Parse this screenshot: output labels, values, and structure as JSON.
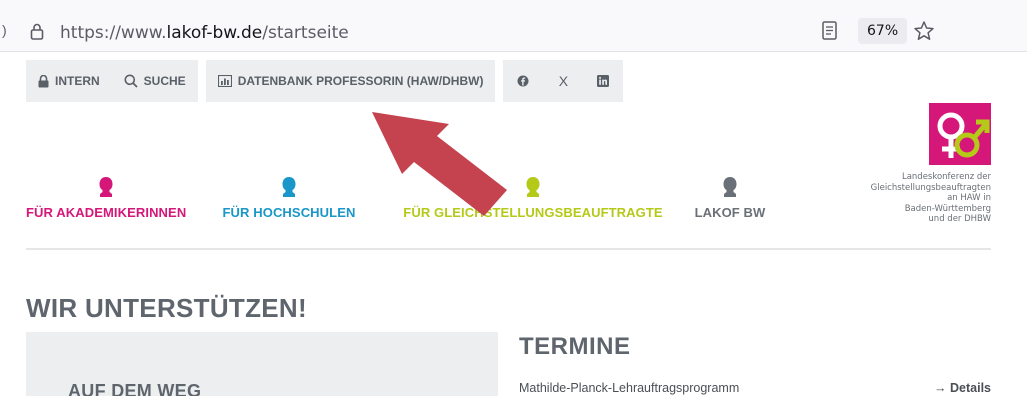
{
  "browser": {
    "edge_char": ")",
    "url_prefix": "https://www.",
    "url_domain": "lakof-bw.de",
    "url_path": "/startseite",
    "zoom": "67%",
    "icons": {
      "lock": "lock-icon",
      "reader": "reader-view-icon",
      "star": "bookmark-star-icon"
    }
  },
  "topbar": {
    "intern": "INTERN",
    "suche": "SUCHE",
    "datenbank": "DATENBANK PROFESSORIN (HAW/DHBW)",
    "social": {
      "x_label": "X"
    }
  },
  "categories": [
    {
      "label": "FÜR AKADEMIKERINNEN",
      "color": "#d6177a"
    },
    {
      "label": "FÜR HOCHSCHULEN",
      "color": "#1a96c8"
    },
    {
      "label": "FÜR GLEICHSTELLUNGSBEAUFTRAGTE",
      "color": "#b5c918"
    },
    {
      "label": "LAKOF BW",
      "color": "#6a7077"
    }
  ],
  "logo_text": [
    "Landeskonferenz der",
    "Gleichstellungsbeauftragten",
    "an HAW in",
    "Baden-Württemberg",
    "und der DHBW"
  ],
  "main": {
    "heading": "WIR UNTERSTÜTZEN!",
    "card_title": "AUF DEM WEG",
    "termine_heading": "TERMINE",
    "events": [
      {
        "title": "Mathilde-Planck-Lehrauftragsprogramm",
        "link": "→ Details"
      }
    ]
  },
  "colors": {
    "brand_pink": "#d6177a",
    "brand_lime": "#b5c918",
    "brand_blue": "#1a96c8",
    "arrow_red": "#c5434f"
  }
}
